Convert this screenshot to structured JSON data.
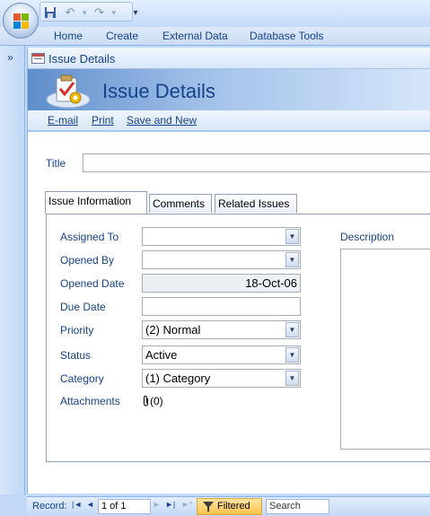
{
  "app": {
    "ribbon_tabs": [
      "Home",
      "Create",
      "External Data",
      "Database Tools"
    ]
  },
  "nav_pane": {
    "toggle_glyph": "»"
  },
  "document": {
    "tab_title": "Issue Details",
    "header_title": "Issue Details",
    "actions": [
      "E-mail",
      "Print",
      "Save and New"
    ]
  },
  "form": {
    "title_label": "Title",
    "title_value": "",
    "tabs": [
      "Issue Information",
      "Comments",
      "Related Issues"
    ],
    "fields": {
      "assigned_to": {
        "label": "Assigned To",
        "value": ""
      },
      "opened_by": {
        "label": "Opened By",
        "value": ""
      },
      "opened_date": {
        "label": "Opened Date",
        "value": "18-Oct-06"
      },
      "due_date": {
        "label": "Due Date",
        "value": ""
      },
      "priority": {
        "label": "Priority",
        "value": "(2) Normal"
      },
      "status": {
        "label": "Status",
        "value": "Active"
      },
      "category": {
        "label": "Category",
        "value": "(1) Category"
      },
      "attachments": {
        "label": "Attachments",
        "value": "(0)"
      }
    },
    "description_label": "Description"
  },
  "status_bar": {
    "record_label": "Record:",
    "record_position": "1 of 1",
    "filter_label": "Filtered",
    "search_label": "Search"
  },
  "colors": {
    "label_blue": "#15428b",
    "header_gradient_start": "#5f8ecb",
    "filter_highlight": "#ffc24c"
  },
  "icons": [
    "office-button-icon",
    "save-icon",
    "undo-icon",
    "redo-icon",
    "customize-qat-icon",
    "form-icon",
    "issue-header-icon",
    "chevron-down-icon",
    "paperclip-icon",
    "first-record-icon",
    "previous-record-icon",
    "next-record-icon",
    "last-record-icon",
    "new-record-icon",
    "filter-icon"
  ]
}
